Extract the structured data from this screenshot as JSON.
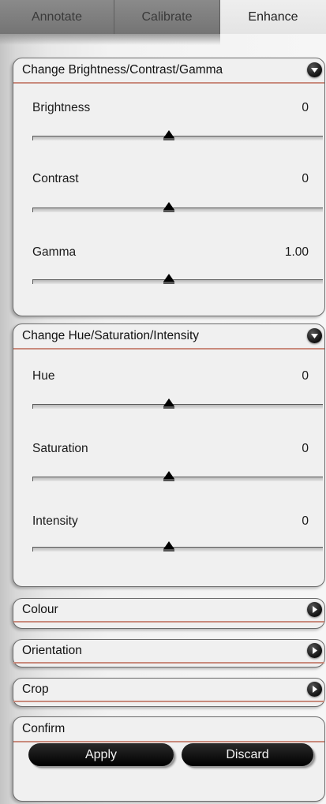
{
  "tabs": [
    {
      "label": "Annotate",
      "active": false
    },
    {
      "label": "Calibrate",
      "active": false
    },
    {
      "label": "Enhance",
      "active": true
    }
  ],
  "panels": {
    "brightness": {
      "title": "Change Brightness/Contrast/Gamma",
      "expanded": true,
      "sliders": [
        {
          "label": "Brightness",
          "value": "0",
          "position": 0.5
        },
        {
          "label": "Contrast",
          "value": "0",
          "position": 0.5
        },
        {
          "label": "Gamma",
          "value": "1.00",
          "position": 0.5
        }
      ]
    },
    "hue": {
      "title": "Change Hue/Saturation/Intensity",
      "expanded": true,
      "sliders": [
        {
          "label": "Hue",
          "value": "0",
          "position": 0.5
        },
        {
          "label": "Saturation",
          "value": "0",
          "position": 0.5
        },
        {
          "label": "Intensity",
          "value": "0",
          "position": 0.5
        }
      ]
    },
    "colour": {
      "title": "Colour",
      "expanded": false
    },
    "orientation": {
      "title": "Orientation",
      "expanded": false
    },
    "crop": {
      "title": "Crop",
      "expanded": false
    },
    "confirm": {
      "title": "Confirm",
      "apply_label": "Apply",
      "discard_label": "Discard"
    }
  },
  "icons": {
    "collapse": "chevron-down-icon",
    "expand": "chevron-right-icon"
  },
  "colors": {
    "header_underline": "#c98a7c",
    "button_bg": "#000000",
    "active_tab": "#e8e8e8",
    "inactive_tab": "#7e7e7e"
  }
}
